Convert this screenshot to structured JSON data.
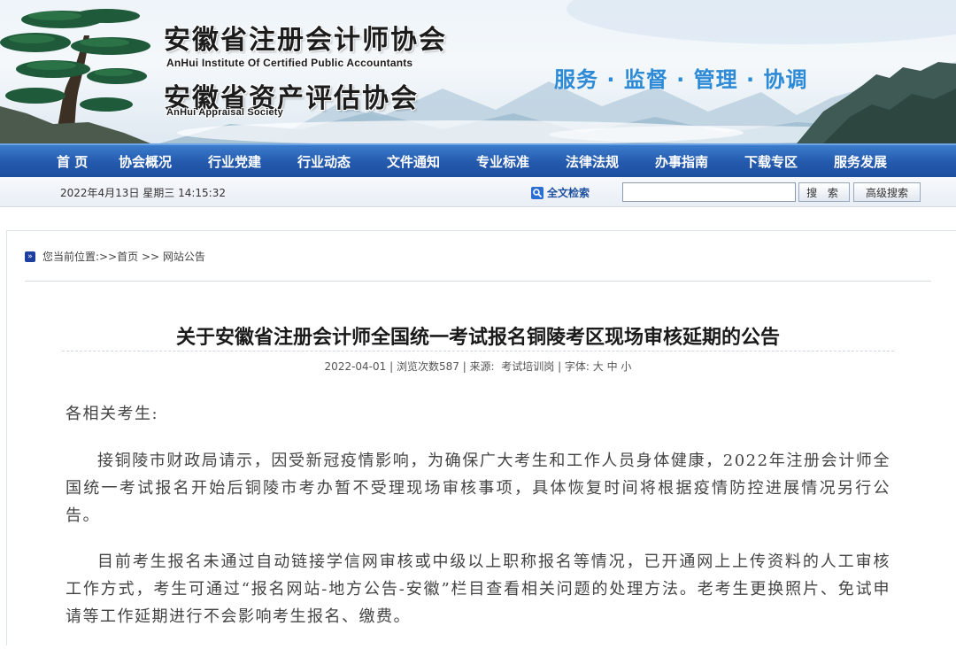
{
  "header": {
    "org_cn_1": "安徽省注册会计师协会",
    "org_en_1": "AnHui Institute Of Certified Public Accountants",
    "org_cn_2": "安徽省资产评估协会",
    "org_en_2": "AnHui Appraisal Society",
    "slogan": "服务 · 监督 · 管理 · 协调",
    "slogan_color": "#2d8ad6"
  },
  "nav": {
    "items": [
      "首 页",
      "协会概况",
      "行业党建",
      "行业动态",
      "文件通知",
      "专业标准",
      "法律法规",
      "办事指南",
      "下载专区",
      "服务发展"
    ],
    "bg_color": "#2459ad"
  },
  "utility": {
    "date_time": "2022年4月13日 星期三 14:15:32",
    "search_label": "全文检索",
    "search_icon": "magnifier-icon",
    "search_value": "",
    "search_button": "搜 索",
    "advanced_button": "高级搜索"
  },
  "breadcrumb": {
    "icon": "double-chevron-icon",
    "text": "您当前位置:>>首页 >> 网站公告"
  },
  "article": {
    "title": "关于安徽省注册会计师全国统一考试报名铜陵考区现场审核延期的公告",
    "meta": {
      "date": "2022-04-01",
      "views": "浏览次数587",
      "source_label": "来源:",
      "source": "考试培训岗",
      "font_label": "字体:",
      "font_sizes": "大 中 小"
    },
    "greeting": "各相关考生:",
    "paragraphs": [
      "接铜陵市财政局请示，因受新冠疫情影响，为确保广大考生和工作人员身体健康，2022年注册会计师全国统一考试报名开始后铜陵市考办暂不受理现场审核事项，具体恢复时间将根据疫情防控进展情况另行公告。",
      "目前考生报名未通过自动链接学信网审核或中级以上职称报名等情况，已开通网上上传资料的人工审核工作方式，考生可通过“报名网站-地方公告-安徽”栏目查看相关问题的处理方法。老考生更换照片、免试申请等工作延期进行不会影响考生报名、缴费。"
    ]
  }
}
